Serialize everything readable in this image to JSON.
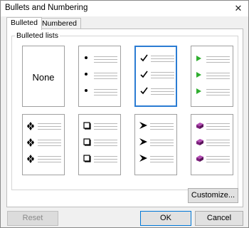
{
  "window": {
    "title": "Bullets and Numbering",
    "close_glyph": "✕"
  },
  "tabs": [
    {
      "label": "Bulleted",
      "active": true
    },
    {
      "label": "Numbered",
      "active": false
    }
  ],
  "group": {
    "label": "Bulleted lists"
  },
  "styles": [
    {
      "id": "none",
      "label": "None",
      "symbol": "none",
      "selected": false
    },
    {
      "id": "dot",
      "symbol": "dot",
      "selected": false
    },
    {
      "id": "check",
      "symbol": "check",
      "selected": true
    },
    {
      "id": "green-arrow",
      "symbol": "green-arrow",
      "selected": false
    },
    {
      "id": "diamond",
      "symbol": "diamond",
      "selected": false
    },
    {
      "id": "square",
      "symbol": "square",
      "selected": false
    },
    {
      "id": "arrowhead",
      "symbol": "arrowhead",
      "selected": false
    },
    {
      "id": "book",
      "symbol": "book",
      "selected": false
    }
  ],
  "buttons": {
    "customize": "Customize...",
    "reset": "Reset",
    "ok": "OK",
    "cancel": "Cancel"
  },
  "colors": {
    "selection": "#2b7cd3",
    "green_arrow": "#2fae2f",
    "book": "#7b1f7b"
  }
}
